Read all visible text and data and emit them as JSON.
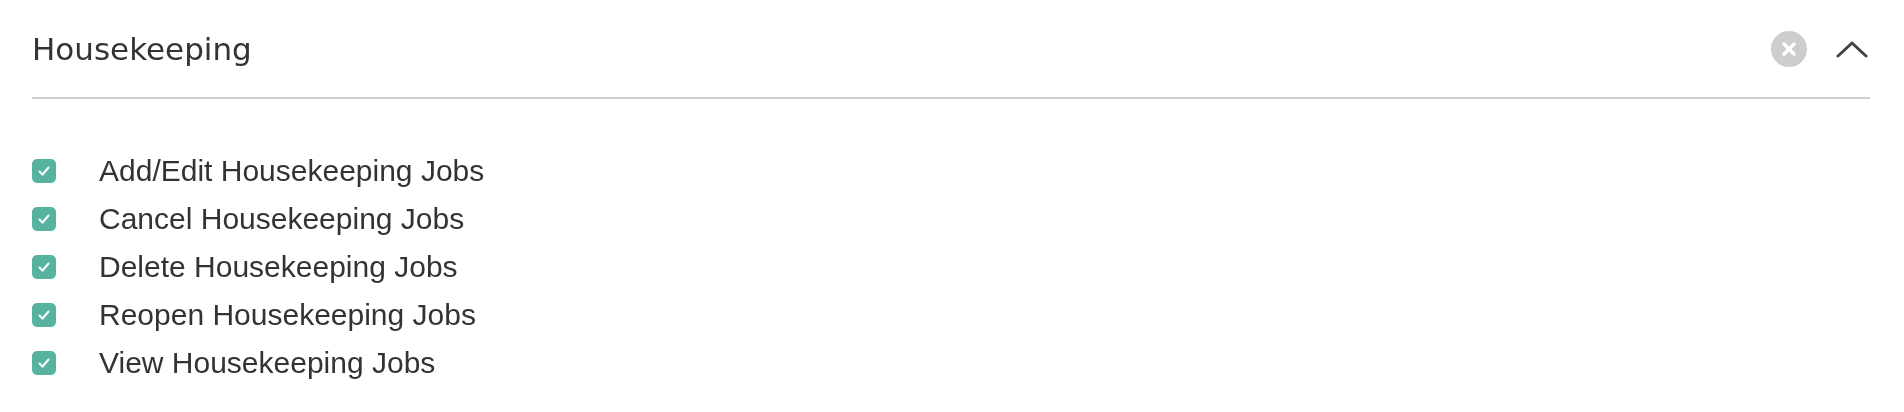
{
  "section": {
    "title": "Housekeeping",
    "expanded": true
  },
  "permissions": [
    {
      "label": "Add/Edit Housekeeping Jobs",
      "checked": true
    },
    {
      "label": "Cancel Housekeeping Jobs",
      "checked": true
    },
    {
      "label": "Delete Housekeeping Jobs",
      "checked": true
    },
    {
      "label": "Reopen Housekeeping Jobs",
      "checked": true
    },
    {
      "label": "View Housekeeping Jobs",
      "checked": true
    }
  ]
}
